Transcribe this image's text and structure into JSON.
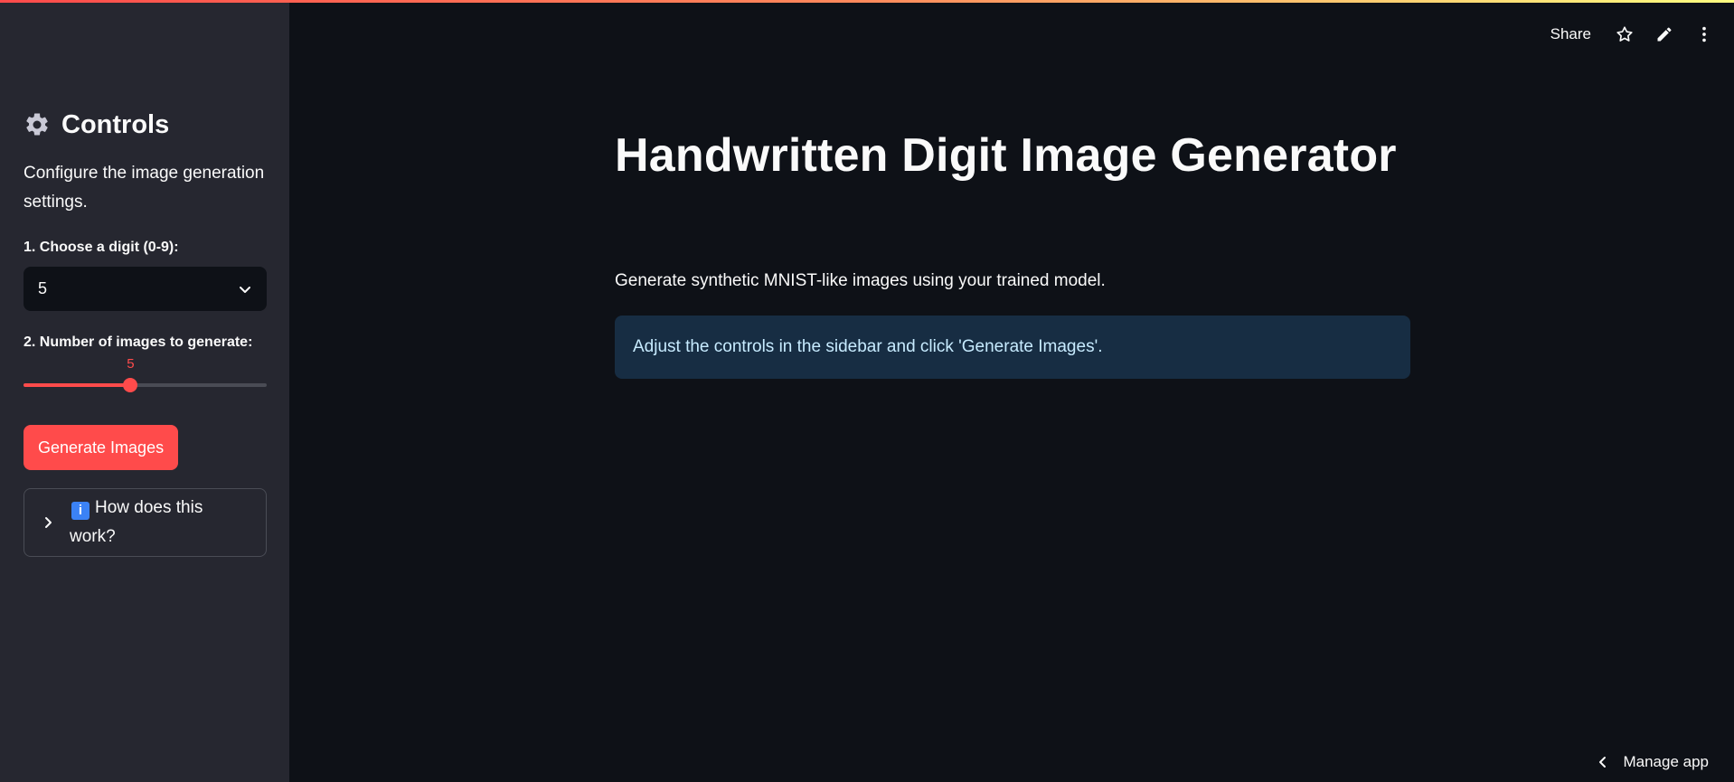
{
  "app": {
    "accent_color": "#ff4b4b",
    "background_color": "#0e1117",
    "sidebar_color": "#262730"
  },
  "sidebar": {
    "title": "Controls",
    "title_icon": "gear-icon",
    "description": "Configure the image generation settings.",
    "digit_select": {
      "label": "1. Choose a digit (0-9):",
      "value": "5"
    },
    "count_slider": {
      "label": "2. Number of images to generate:",
      "value": "5",
      "min": 1,
      "max": 10,
      "fraction": 0.44
    },
    "generate_button": "Generate Images",
    "expander": {
      "icon": "info-icon",
      "icon_text": "i",
      "label": "How does this work?"
    }
  },
  "header": {
    "share_label": "Share",
    "icons": [
      "star-icon",
      "edit-icon",
      "more-vertical-icon"
    ]
  },
  "main": {
    "title": "Handwritten Digit Image Generator",
    "subtitle": "Generate synthetic MNIST-like images using your trained model.",
    "info_message": "Adjust the controls in the sidebar and click 'Generate Images'."
  },
  "footer": {
    "manage_app_label": "Manage app"
  }
}
